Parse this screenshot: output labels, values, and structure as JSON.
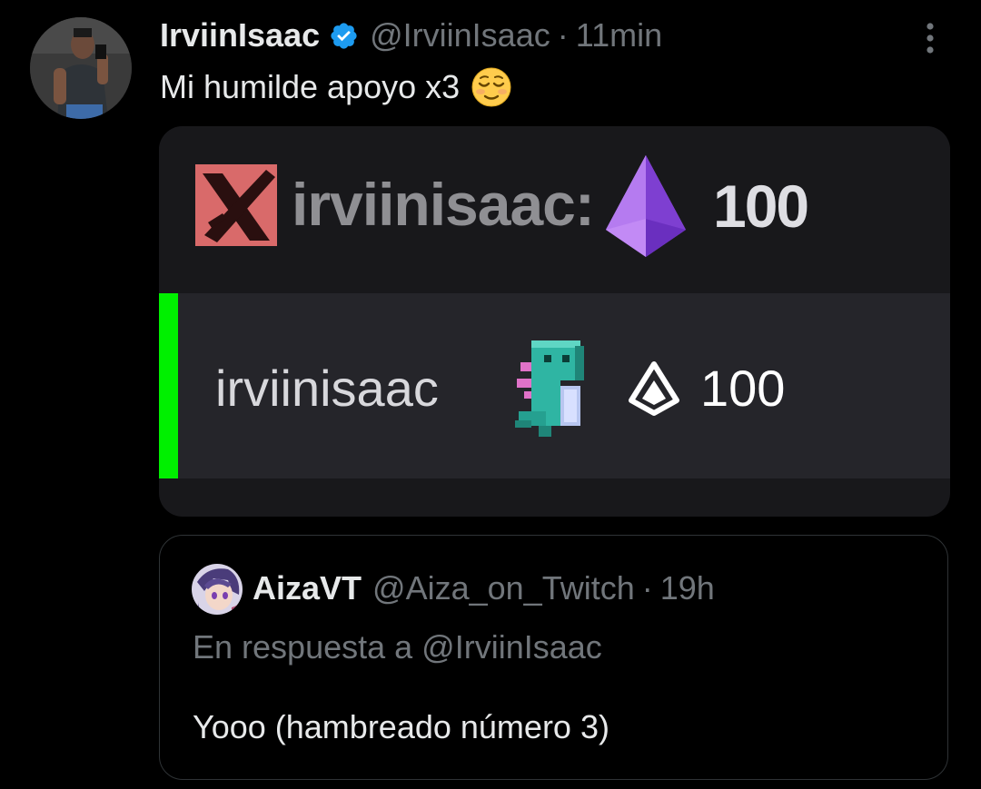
{
  "tweet": {
    "author": {
      "display_name": "IrviinIsaac",
      "handle": "@IrviinIsaac",
      "verified": true,
      "avatar_icon": "user-photo-avatar"
    },
    "separator": "·",
    "time": "11min",
    "text": "Mi humilde apoyo x3",
    "emoji": "relieved-face-emoji",
    "more_icon": "more-vertical-icon"
  },
  "media": {
    "row1": {
      "badge_icon": "x-badge-icon",
      "username": "irviinisaac:",
      "gem_icon": "purple-bits-gem-icon",
      "amount": "100"
    },
    "row2": {
      "highlight_color": "#00f000",
      "username": "irviinisaac",
      "badge_icon": "dino-badge-icon",
      "bits_icon": "bits-outline-icon",
      "amount": "100"
    }
  },
  "quote": {
    "author": {
      "display_name": "AizaVT",
      "handle": "@Aiza_on_Twitch",
      "avatar_icon": "anime-avatar"
    },
    "separator": "·",
    "time": "19h",
    "reply_to": "En respuesta a @IrviinIsaac",
    "text": "Yooo (hambreado número 3)"
  },
  "colors": {
    "background": "#000000",
    "primary_text": "#e7e9ea",
    "secondary_text": "#71767b",
    "verified_blue": "#1d9bf0",
    "border": "#2f3336"
  }
}
